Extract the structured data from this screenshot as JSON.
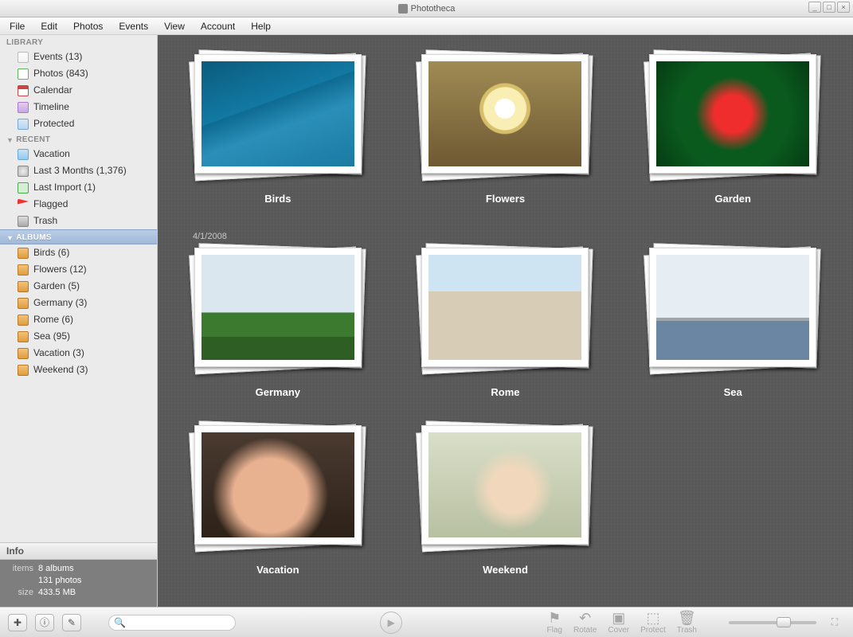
{
  "app": {
    "title": "Phototheca"
  },
  "menu": [
    "File",
    "Edit",
    "Photos",
    "Events",
    "View",
    "Account",
    "Help"
  ],
  "window_controls": {
    "min": "_",
    "max": "□",
    "close": "×"
  },
  "sidebar": {
    "sections": {
      "library": {
        "header": "LIBRARY"
      },
      "recent": {
        "header": "RECENT"
      },
      "albums": {
        "header": "ALBUMS"
      }
    },
    "library_items": [
      {
        "label": "Events (13)",
        "data_name": "sidebar-events",
        "icon": "ic-events"
      },
      {
        "label": "Photos (843)",
        "data_name": "sidebar-photos",
        "icon": "ic-photos"
      },
      {
        "label": "Calendar",
        "data_name": "sidebar-calendar",
        "icon": "ic-cal"
      },
      {
        "label": "Timeline",
        "data_name": "sidebar-timeline",
        "icon": "ic-time"
      },
      {
        "label": "Protected",
        "data_name": "sidebar-protected",
        "icon": "ic-prot"
      }
    ],
    "recent_items": [
      {
        "label": "Vacation",
        "data_name": "sidebar-recent-vacation",
        "icon": "ic-vac"
      },
      {
        "label": "Last 3 Months (1,376)",
        "data_name": "sidebar-last-3-months",
        "icon": "ic-clock"
      },
      {
        "label": "Last Import (1)",
        "data_name": "sidebar-last-import",
        "icon": "ic-import"
      },
      {
        "label": "Flagged",
        "data_name": "sidebar-flagged",
        "icon": "ic-flag"
      },
      {
        "label": "Trash",
        "data_name": "sidebar-trash",
        "icon": "ic-trash"
      }
    ],
    "album_items": [
      {
        "label": "Birds (6)",
        "data_name": "sidebar-album-birds",
        "icon": "ic-album"
      },
      {
        "label": "Flowers (12)",
        "data_name": "sidebar-album-flowers",
        "icon": "ic-album"
      },
      {
        "label": "Garden (5)",
        "data_name": "sidebar-album-garden",
        "icon": "ic-album"
      },
      {
        "label": "Germany (3)",
        "data_name": "sidebar-album-germany",
        "icon": "ic-album"
      },
      {
        "label": "Rome (6)",
        "data_name": "sidebar-album-rome",
        "icon": "ic-album"
      },
      {
        "label": "Sea (95)",
        "data_name": "sidebar-album-sea",
        "icon": "ic-album"
      },
      {
        "label": "Vacation (3)",
        "data_name": "sidebar-album-vacation",
        "icon": "ic-album"
      },
      {
        "label": "Weekend (3)",
        "data_name": "sidebar-album-weekend",
        "icon": "ic-album"
      }
    ]
  },
  "info": {
    "header": "Info",
    "items_label": "items",
    "items_value1": "8 albums",
    "items_value2": "131 photos",
    "size_label": "size",
    "size_value": "433.5 MB"
  },
  "content": {
    "date_separator": "4/1/2008",
    "albums": [
      {
        "title": "Birds",
        "data_name": "album-birds",
        "thumb": "ph-birds"
      },
      {
        "title": "Flowers",
        "data_name": "album-flowers",
        "thumb": "ph-flowers"
      },
      {
        "title": "Garden",
        "data_name": "album-garden",
        "thumb": "ph-garden"
      },
      {
        "title": "Germany",
        "data_name": "album-germany",
        "thumb": "ph-germany"
      },
      {
        "title": "Rome",
        "data_name": "album-rome",
        "thumb": "ph-rome"
      },
      {
        "title": "Sea",
        "data_name": "album-sea",
        "thumb": "ph-sea"
      },
      {
        "title": "Vacation",
        "data_name": "album-vacation",
        "thumb": "ph-vacation"
      },
      {
        "title": "Weekend",
        "data_name": "album-weekend",
        "thumb": "ph-weekend"
      }
    ]
  },
  "toolbar": {
    "add_glyph": "✚",
    "info_glyph": "ⓘ",
    "edit_glyph": "✎",
    "play_glyph": "▶",
    "tools": [
      {
        "label": "Flag",
        "glyph": "⚑",
        "data_name": "tool-flag"
      },
      {
        "label": "Rotate",
        "glyph": "↶",
        "data_name": "tool-rotate"
      },
      {
        "label": "Cover",
        "glyph": "▣",
        "data_name": "tool-cover"
      },
      {
        "label": "Protect",
        "glyph": "⬚",
        "data_name": "tool-protect"
      },
      {
        "label": "Trash",
        "glyph": "🗑",
        "data_name": "tool-trash"
      }
    ],
    "zoom": {
      "value_pct": 65
    },
    "fullscreen_glyph": "⛶"
  },
  "search": {
    "placeholder": ""
  }
}
